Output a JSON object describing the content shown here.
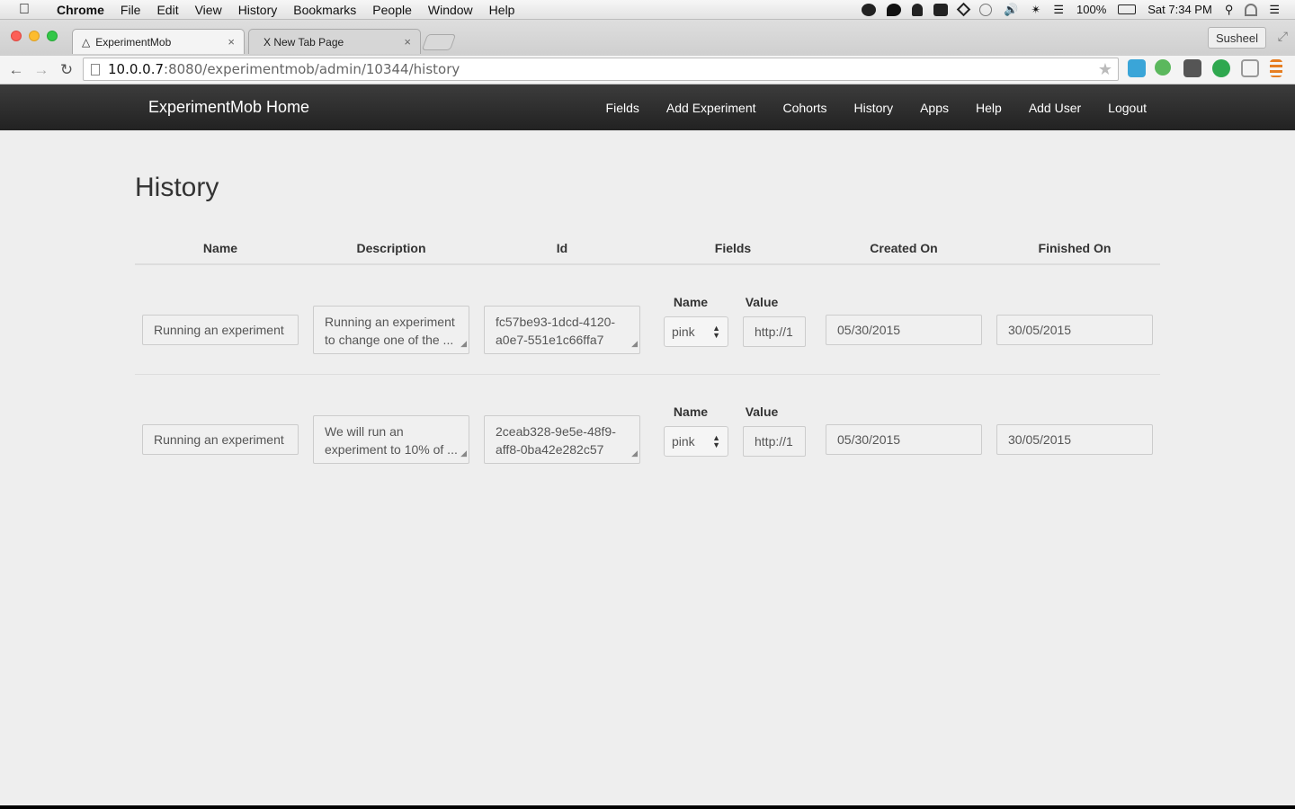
{
  "menubar": {
    "app": "Chrome",
    "items": [
      "File",
      "Edit",
      "View",
      "History",
      "Bookmarks",
      "People",
      "Window",
      "Help"
    ],
    "battery": "100%",
    "clock": "Sat 7:34 PM"
  },
  "browser": {
    "tabs": [
      {
        "title": "ExperimentMob",
        "close": "×"
      },
      {
        "title": "X New Tab Page",
        "close": "×"
      }
    ],
    "profile": "Susheel",
    "url_host": "10.0.0.7",
    "url_rest": ":8080/experimentmob/admin/10344/history"
  },
  "navbar": {
    "brand": "ExperimentMob Home",
    "links": [
      "Fields",
      "Add Experiment",
      "Cohorts",
      "History",
      "Apps",
      "Help",
      "Add User",
      "Logout"
    ]
  },
  "page": {
    "title": "History",
    "columns": [
      "Name",
      "Description",
      "Id",
      "Fields",
      "Created On",
      "Finished On"
    ],
    "field_headers": {
      "name": "Name",
      "value": "Value"
    },
    "rows": [
      {
        "name": "Running an experiment",
        "description": "Running an experiment to change one of the ...",
        "id": "fc57be93-1dcd-4120-a0e7-551e1c66ffa7",
        "field_name": "pink",
        "field_value": "http://1",
        "created_on": "05/30/2015",
        "finished_on": "30/05/2015"
      },
      {
        "name": "Running an experiment",
        "description": "We will run an experiment to 10% of ...",
        "id": "2ceab328-9e5e-48f9-aff8-0ba42e282c57",
        "field_name": "pink",
        "field_value": "http://1",
        "created_on": "05/30/2015",
        "finished_on": "30/05/2015"
      }
    ]
  }
}
